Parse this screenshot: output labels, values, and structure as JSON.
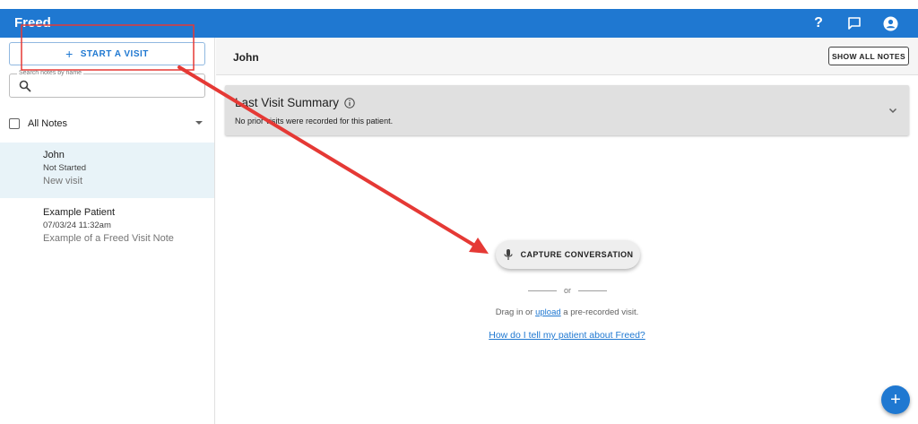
{
  "app": {
    "title": "Freed"
  },
  "topbar": {
    "help_label": "?",
    "icons": [
      "help-icon",
      "chat-icon",
      "account-icon"
    ]
  },
  "sidebar": {
    "start_visit_label": "START A VISIT",
    "start_visit_icon": "plus-icon",
    "search": {
      "legend": "Search notes by name",
      "value": ""
    },
    "filter_label": "All Notes",
    "notes": [
      {
        "name": "John",
        "status": "Not Started",
        "subtitle": "New visit",
        "selected": true
      },
      {
        "name": "Example Patient",
        "status": "07/03/24 11:32am",
        "subtitle": "Example of a Freed Visit Note",
        "selected": false
      }
    ]
  },
  "main": {
    "patient_name": "John",
    "show_all_notes_label": "SHOW ALL NOTES",
    "summary": {
      "title": "Last Visit Summary",
      "text": "No prior visits were recorded for this patient."
    },
    "capture_label": "CAPTURE CONVERSATION",
    "or_label": "or",
    "drag_prefix": "Drag in or",
    "upload_label": "upload",
    "drag_suffix": "a pre-recorded visit.",
    "help_link": "How do I tell my patient about Freed?"
  },
  "fab": {
    "label": "+"
  },
  "colors": {
    "brand_blue": "#1f78d1",
    "selected_row": "#e8f3f8",
    "annotation_red": "#e53935"
  }
}
